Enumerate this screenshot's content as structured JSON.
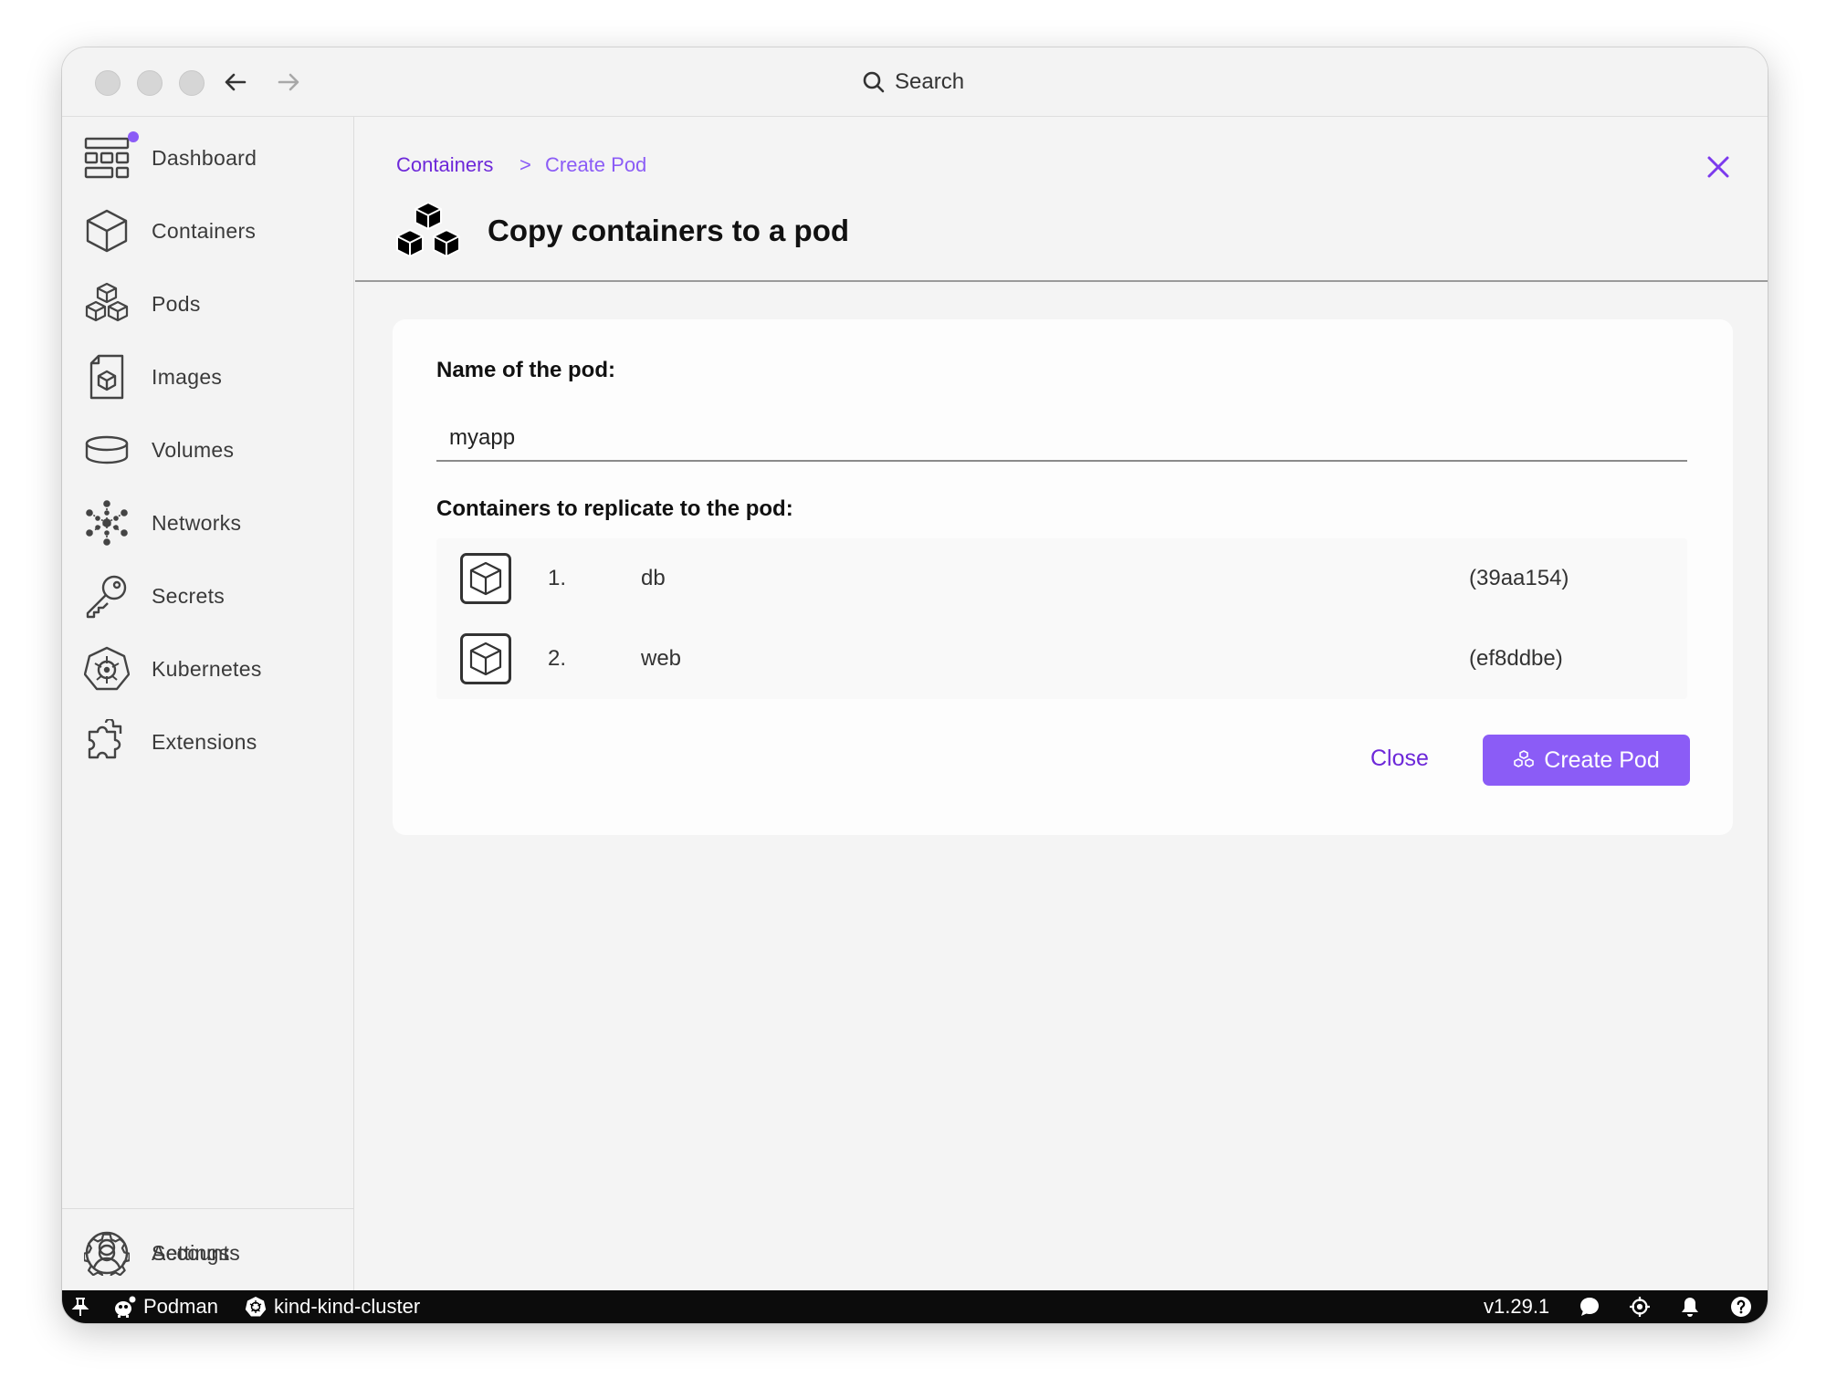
{
  "titlebar": {
    "search_label": "Search"
  },
  "sidebar": {
    "items": [
      {
        "label": "Dashboard",
        "icon": "dashboard-icon"
      },
      {
        "label": "Containers",
        "icon": "container-icon"
      },
      {
        "label": "Pods",
        "icon": "pods-icon"
      },
      {
        "label": "Images",
        "icon": "image-icon"
      },
      {
        "label": "Volumes",
        "icon": "volume-icon"
      },
      {
        "label": "Networks",
        "icon": "network-icon"
      },
      {
        "label": "Secrets",
        "icon": "key-icon"
      },
      {
        "label": "Kubernetes",
        "icon": "kubernetes-icon"
      },
      {
        "label": "Extensions",
        "icon": "puzzle-icon"
      }
    ],
    "bottom_items": [
      {
        "label": "Accounts",
        "icon": "account-icon"
      },
      {
        "label": "Settings",
        "icon": "gear-icon"
      }
    ]
  },
  "header": {
    "breadcrumb_parent": "Containers",
    "breadcrumb_separator": ">",
    "breadcrumb_current": "Create Pod",
    "title": "Copy containers to a pod"
  },
  "form": {
    "pod_name_label": "Name of the pod:",
    "pod_name_value": "myapp",
    "containers_label": "Containers to replicate to the pod:",
    "containers": [
      {
        "index": "1.",
        "name": "db",
        "id": "(39aa154)"
      },
      {
        "index": "2.",
        "name": "web",
        "id": "(ef8ddbe)"
      }
    ],
    "close_label": "Close",
    "create_label": "Create Pod"
  },
  "statusbar": {
    "engine": "Podman",
    "context": "kind-kind-cluster",
    "version": "v1.29.1"
  },
  "colors": {
    "accent": "#8b5cf6",
    "accent_dark": "#6d28d9"
  }
}
